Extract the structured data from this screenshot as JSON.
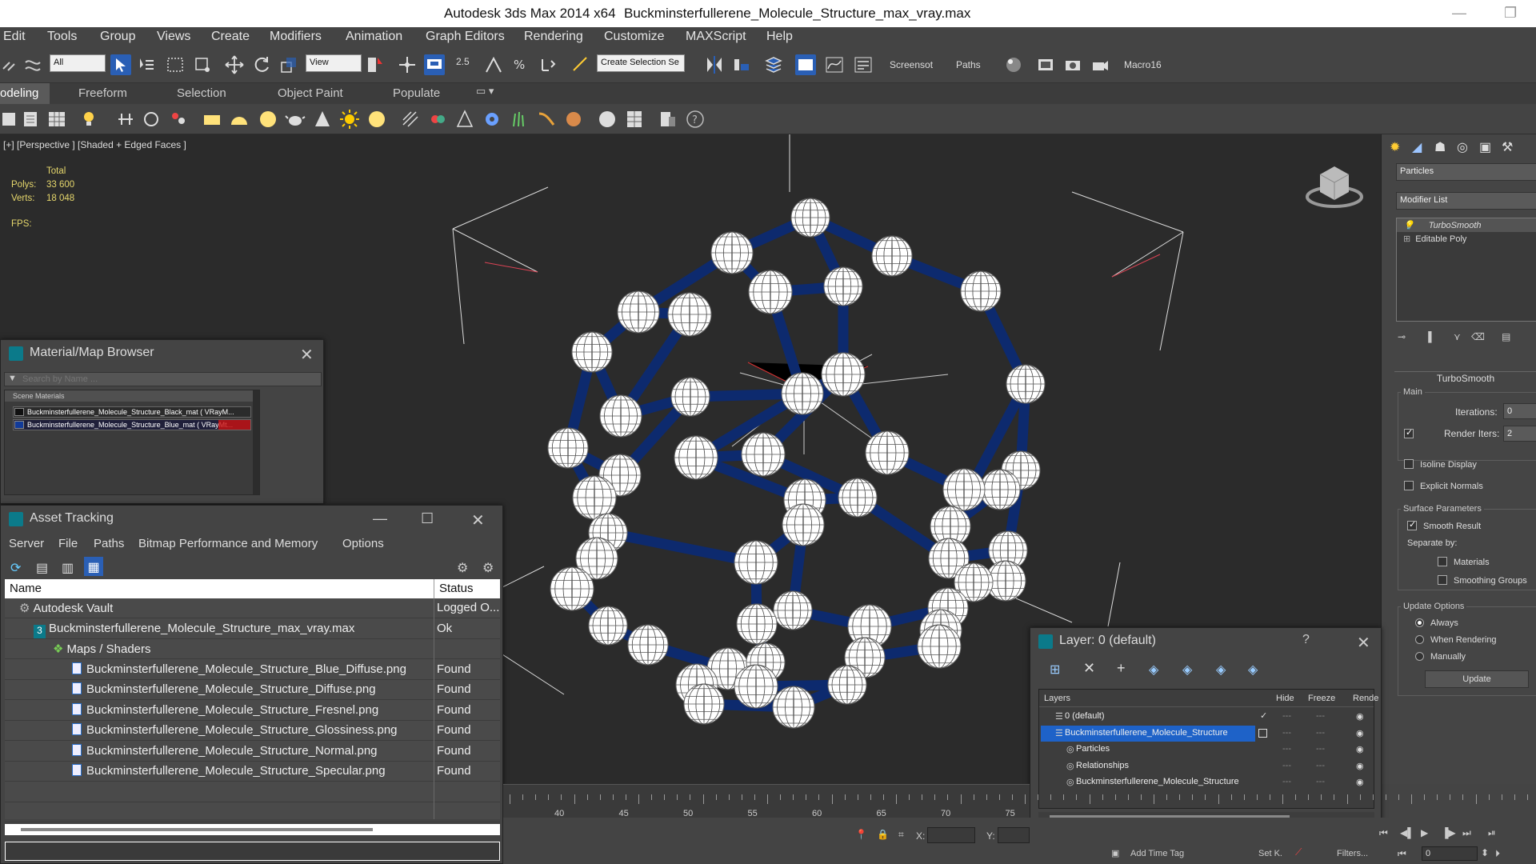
{
  "titlebar": {
    "app_title": "Autodesk 3ds Max  2014 x64",
    "file_title": "Buckminsterfullerene_Molecule_Structure_max_vray.max"
  },
  "menu": [
    "Edit",
    "Tools",
    "Group",
    "Views",
    "Create",
    "Modifiers",
    "Animation",
    "Graph Editors",
    "Rendering",
    "Customize",
    "MAXScript",
    "Help"
  ],
  "toolbar": {
    "filter": "All",
    "ref_coord": "View",
    "selection_set": "Create Selection Se",
    "snap_label": "2.5",
    "screenshot_label": "Screensot",
    "paths_label": "Paths",
    "macro_label": "Macro16"
  },
  "ribbon": [
    "odeling",
    "Freeform",
    "Selection",
    "Object Paint",
    "Populate"
  ],
  "viewport": {
    "label": "[+] [Perspective ] [Shaded + Edged Faces ]",
    "stats_header": "Total",
    "polys_label": "Polys:",
    "polys": "33 600",
    "verts_label": "Verts:",
    "verts": "18 048",
    "fps_label": "FPS:"
  },
  "command_panel": {
    "name_field": "Particles",
    "modifier_list": "Modifier List",
    "stack": [
      "TurboSmooth",
      "Editable Poly"
    ],
    "rollout_title": "TurboSmooth",
    "main_group": "Main",
    "iterations_label": "Iterations:",
    "iterations": "0",
    "render_iters_label": "Render Iters:",
    "render_iters": "2",
    "isoline": "Isoline Display",
    "explicit_normals": "Explicit Normals",
    "surface_group": "Surface Parameters",
    "smooth_result": "Smooth Result",
    "separate_by": "Separate by:",
    "materials": "Materials",
    "smoothing_groups": "Smoothing Groups",
    "update_group": "Update Options",
    "always": "Always",
    "when_rendering": "When Rendering",
    "manually": "Manually",
    "update_button": "Update"
  },
  "material_browser": {
    "title": "Material/Map Browser",
    "search_placeholder": "Search by Name ...",
    "section": "Scene Materials",
    "items": [
      "Buckminsterfullerene_Molecule_Structure_Black_mat  ( VRayM...",
      "Buckminsterfullerene_Molecule_Structure_Blue_mat  ( VRayMt..."
    ]
  },
  "asset_tracking": {
    "title": "Asset Tracking",
    "menu": [
      "Server",
      "File",
      "Paths",
      "Bitmap Performance and Memory",
      "Options"
    ],
    "col_name": "Name",
    "col_status": "Status",
    "rows": [
      {
        "name": "Autodesk Vault",
        "status": "Logged O...",
        "indent": 0
      },
      {
        "name": "Buckminsterfullerene_Molecule_Structure_max_vray.max",
        "status": "Ok",
        "indent": 1
      },
      {
        "name": "Maps / Shaders",
        "status": "",
        "indent": 2
      },
      {
        "name": "Buckminsterfullerene_Molecule_Structure_Blue_Diffuse.png",
        "status": "Found",
        "indent": 3
      },
      {
        "name": "Buckminsterfullerene_Molecule_Structure_Diffuse.png",
        "status": "Found",
        "indent": 3
      },
      {
        "name": "Buckminsterfullerene_Molecule_Structure_Fresnel.png",
        "status": "Found",
        "indent": 3
      },
      {
        "name": "Buckminsterfullerene_Molecule_Structure_Glossiness.png",
        "status": "Found",
        "indent": 3
      },
      {
        "name": "Buckminsterfullerene_Molecule_Structure_Normal.png",
        "status": "Found",
        "indent": 3
      },
      {
        "name": "Buckminsterfullerene_Molecule_Structure_Specular.png",
        "status": "Found",
        "indent": 3
      }
    ]
  },
  "layer_window": {
    "title": "Layer: 0 (default)",
    "help": "?",
    "col_layers": "Layers",
    "col_hide": "Hide",
    "col_freeze": "Freeze",
    "col_render": "Rende",
    "rows": [
      {
        "name": "0 (default)",
        "indent": 0
      },
      {
        "name": "Buckminsterfullerene_Molecule_Structure",
        "indent": 0
      },
      {
        "name": "Particles",
        "indent": 1
      },
      {
        "name": "Relationships",
        "indent": 1
      },
      {
        "name": "Buckminsterfullerene_Molecule_Structure",
        "indent": 1
      }
    ]
  },
  "timeline": {
    "ticks": [
      "40",
      "45",
      "50",
      "55",
      "60",
      "65",
      "70",
      "75"
    ]
  },
  "status": {
    "x_label": "X:",
    "y_label": "Y:",
    "add_time_tag": "Add Time Tag",
    "set_key": "Set K.",
    "filters": "Filters...",
    "frame": "0"
  },
  "colors": {
    "accent": "#2a5fb5",
    "selected": "#1e62c8",
    "bond": "#0d2a6e",
    "atom": "#ffffff",
    "viewport_bg": "#2b2b2b"
  }
}
